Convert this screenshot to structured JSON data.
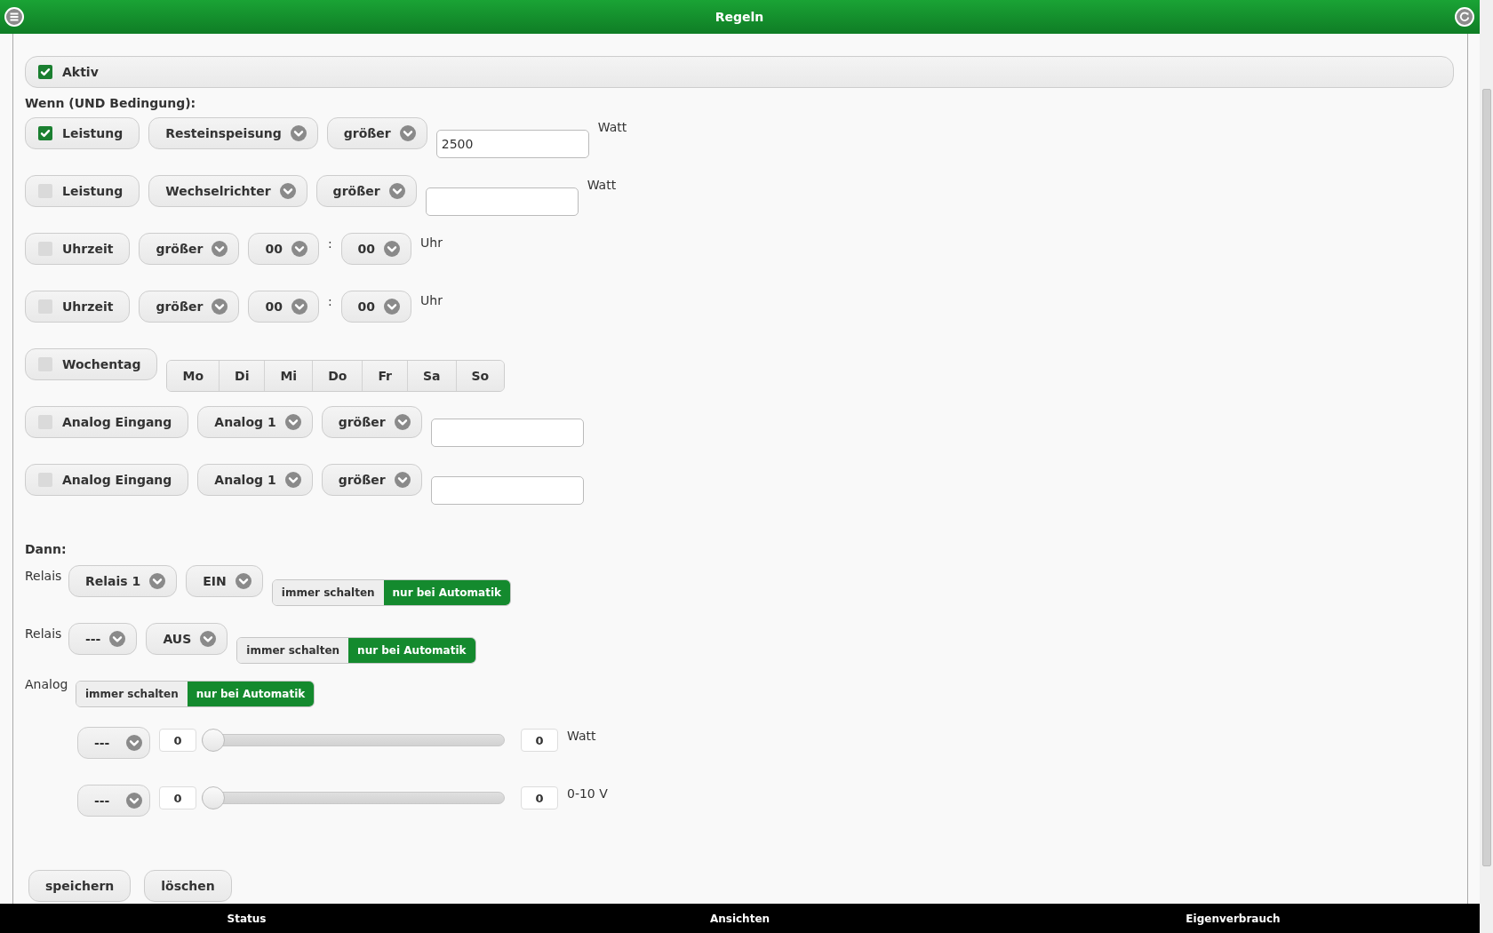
{
  "header": {
    "title": "Regeln"
  },
  "active": {
    "label": "Aktiv",
    "checked": true
  },
  "conditions_heading": "Wenn (UND Bedingung):",
  "conditions": [
    {
      "kind": "value",
      "label": "Leistung",
      "checked": true,
      "selects": [
        "Resteinspeisung",
        "größer"
      ],
      "value": "2500",
      "unit": "Watt"
    },
    {
      "kind": "value",
      "label": "Leistung",
      "checked": false,
      "selects": [
        "Wechselrichter",
        "größer"
      ],
      "unit": "Watt"
    },
    {
      "kind": "time",
      "label": "Uhrzeit",
      "checked": false,
      "selects": [
        "größer",
        "00",
        "00"
      ],
      "separator": ":",
      "unit": "Uhr"
    },
    {
      "kind": "time",
      "label": "Uhrzeit",
      "checked": false,
      "selects": [
        "größer",
        "00",
        "00"
      ],
      "separator": ":",
      "unit": "Uhr"
    },
    {
      "kind": "weekdays",
      "label": "Wochentag",
      "checked": false,
      "days": [
        {
          "label": "Mo",
          "selected": false
        },
        {
          "label": "Di",
          "selected": false
        },
        {
          "label": "Mi",
          "selected": false
        },
        {
          "label": "Do",
          "selected": false
        },
        {
          "label": "Fr",
          "selected": false
        },
        {
          "label": "Sa",
          "selected": false
        },
        {
          "label": "So",
          "selected": false
        }
      ]
    },
    {
      "kind": "value",
      "label": "Analog Eingang",
      "checked": false,
      "selects": [
        "Analog 1",
        "größer"
      ]
    },
    {
      "kind": "value",
      "label": "Analog Eingang",
      "checked": false,
      "selects": [
        "Analog 1",
        "größer"
      ]
    }
  ],
  "actions_heading": "Dann:",
  "actions": [
    {
      "kind": "relay",
      "label": "Relais",
      "selects": [
        "Relais 1",
        "EIN"
      ],
      "modes": [
        {
          "label": "immer schalten",
          "selected": false
        },
        {
          "label": "nur bei Automatik",
          "selected": true
        }
      ]
    },
    {
      "kind": "relay",
      "label": "Relais",
      "selects": [
        "---",
        "AUS"
      ],
      "modes": [
        {
          "label": "immer schalten",
          "selected": false
        },
        {
          "label": "nur bei Automatik",
          "selected": true
        }
      ]
    },
    {
      "kind": "analog",
      "label": "Analog",
      "modes": [
        {
          "label": "immer schalten",
          "selected": false
        },
        {
          "label": "nur bei Automatik",
          "selected": true
        }
      ],
      "sliders": [
        {
          "select": "---",
          "min": "0",
          "level": 0,
          "max": "0",
          "unit": "Watt"
        },
        {
          "select": "---",
          "min": "0",
          "level": 0,
          "max": "0",
          "unit": "0-10 V"
        }
      ]
    }
  ],
  "buttons": [
    "speichern",
    "löschen"
  ],
  "nav": [
    "Status",
    "Ansichten",
    "Eigenverbrauch"
  ]
}
